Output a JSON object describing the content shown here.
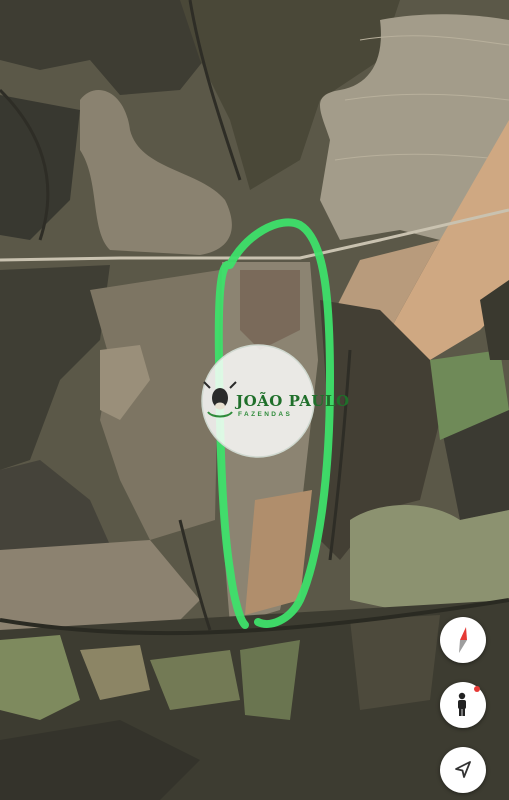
{
  "map": {
    "view": "satellite",
    "highlight_color": "#3ee06a"
  },
  "logo": {
    "line1": "JOÃO PAULO",
    "line2": "FAZENDAS"
  },
  "controls": {
    "compass": {
      "icon": "compass-icon"
    },
    "street_view": {
      "icon": "pegman-icon",
      "indicator_color": "#e53935"
    },
    "my_location": {
      "icon": "navigation-arrow-icon"
    }
  }
}
